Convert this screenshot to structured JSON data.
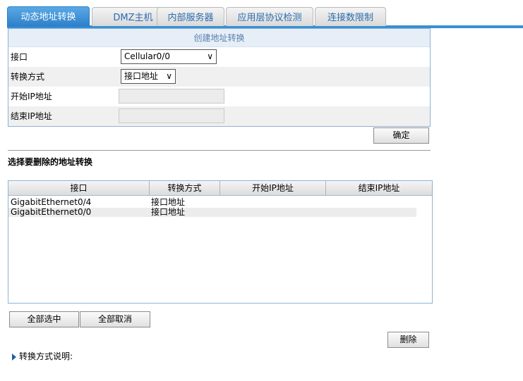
{
  "tabs": [
    {
      "label": "动态地址转换",
      "active": true
    },
    {
      "label": "DMZ主机",
      "active": false
    },
    {
      "label": "内部服务器",
      "active": false
    },
    {
      "label": "应用层协议检测",
      "active": false
    },
    {
      "label": "连接数限制",
      "active": false
    }
  ],
  "create_form": {
    "title": "创建地址转换",
    "interface_label": "接口",
    "interface_value": "Cellular0/0",
    "mode_label": "转换方式",
    "mode_value": "接口地址",
    "start_ip_label": "开始IP地址",
    "start_ip_value": "",
    "end_ip_label": "结束IP地址",
    "end_ip_value": "",
    "ok_label": "确定"
  },
  "delete_section": {
    "title": "选择要删除的地址转换",
    "columns": [
      "接口",
      "转换方式",
      "开始IP地址",
      "结束IP地址"
    ],
    "rows": [
      {
        "interface": "GigabitEthernet0/4",
        "mode": "接口地址",
        "start_ip": "",
        "end_ip": ""
      },
      {
        "interface": "GigabitEthernet0/0",
        "mode": "接口地址",
        "start_ip": "",
        "end_ip": ""
      }
    ],
    "select_all_label": "全部选中",
    "deselect_all_label": "全部取消",
    "delete_label": "删除"
  },
  "help": {
    "label": "转换方式说明:"
  },
  "colors": {
    "tab_active": "#2c7fc8",
    "tab_text": "#2b6db0",
    "panel_border": "#8fb3d6"
  }
}
